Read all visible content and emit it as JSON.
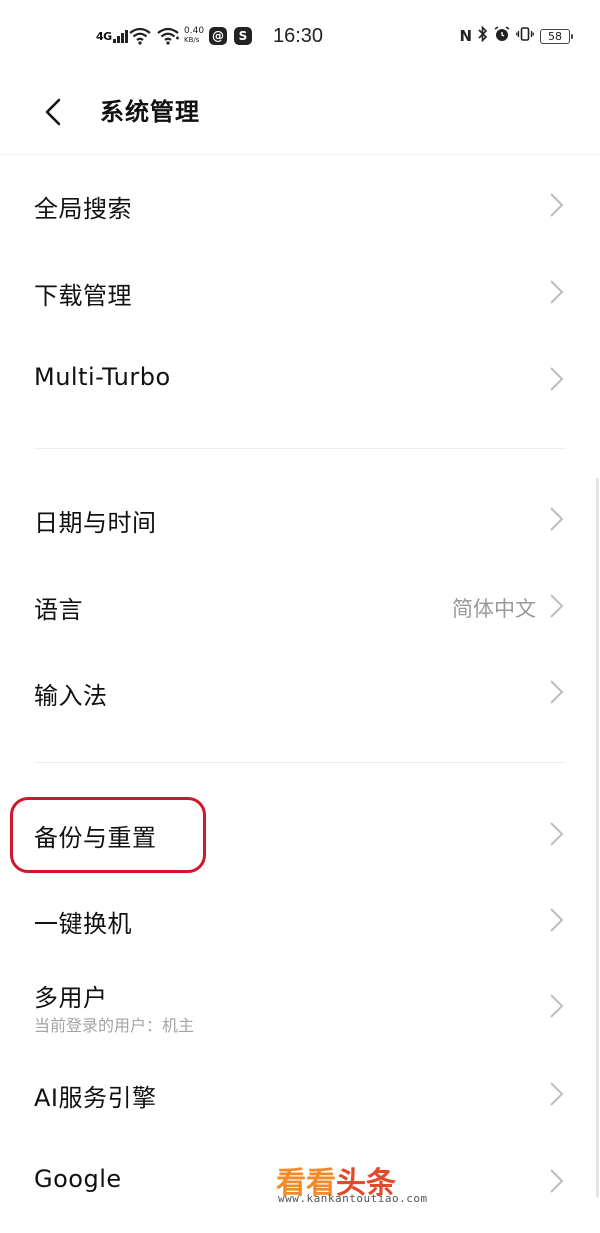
{
  "status_bar": {
    "network": "4G",
    "speed_value": "0.40",
    "speed_unit": "KB/s",
    "time": "16:30",
    "battery": "58",
    "nfc": "N"
  },
  "header": {
    "title": "系统管理"
  },
  "items": [
    {
      "label": "全局搜索"
    },
    {
      "label": "下载管理"
    },
    {
      "label": "Multi-Turbo"
    },
    {
      "label": "日期与时间"
    },
    {
      "label": "语言",
      "value": "简体中文"
    },
    {
      "label": "输入法"
    },
    {
      "label": "备份与重置"
    },
    {
      "label": "一键换机"
    },
    {
      "label": "多用户",
      "sub": "当前登录的用户：机主"
    },
    {
      "label": "AI服务引擎"
    },
    {
      "label": "Google"
    }
  ],
  "watermark": {
    "brand_part1": "看看",
    "brand_part2": "头条",
    "url": "www.kankantoutiao.com"
  },
  "colors": {
    "highlight": "#d0172c",
    "secondary_text": "#9a9a9a",
    "chevron": "#bdbdbd"
  }
}
